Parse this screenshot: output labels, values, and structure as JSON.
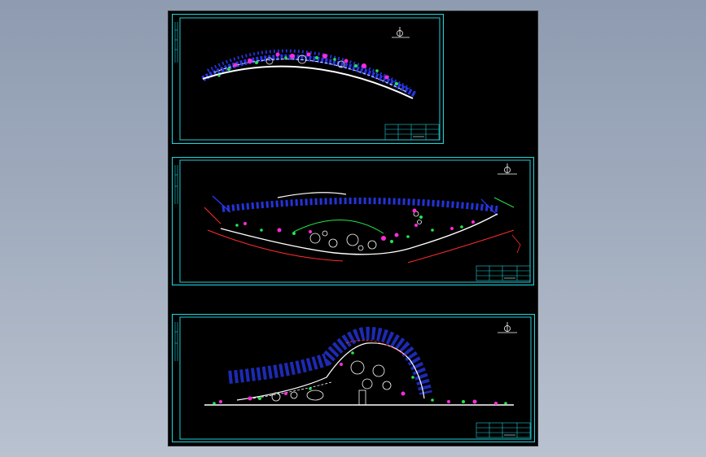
{
  "viewer": {
    "background": "#000000",
    "frame_color": "#1fd0d8",
    "sheets": [
      {
        "id": "sheet-1",
        "name": "top-curved-plan"
      },
      {
        "id": "sheet-2",
        "name": "middle-wide-plan"
      },
      {
        "id": "sheet-3",
        "name": "bottom-hill-plan"
      }
    ]
  },
  "colors": {
    "cyan": "#1fd0d8",
    "blue": "#2a3cff",
    "magenta": "#ff2bd8",
    "green": "#23e64a",
    "white": "#ffffff",
    "red": "#ff2a2a"
  }
}
